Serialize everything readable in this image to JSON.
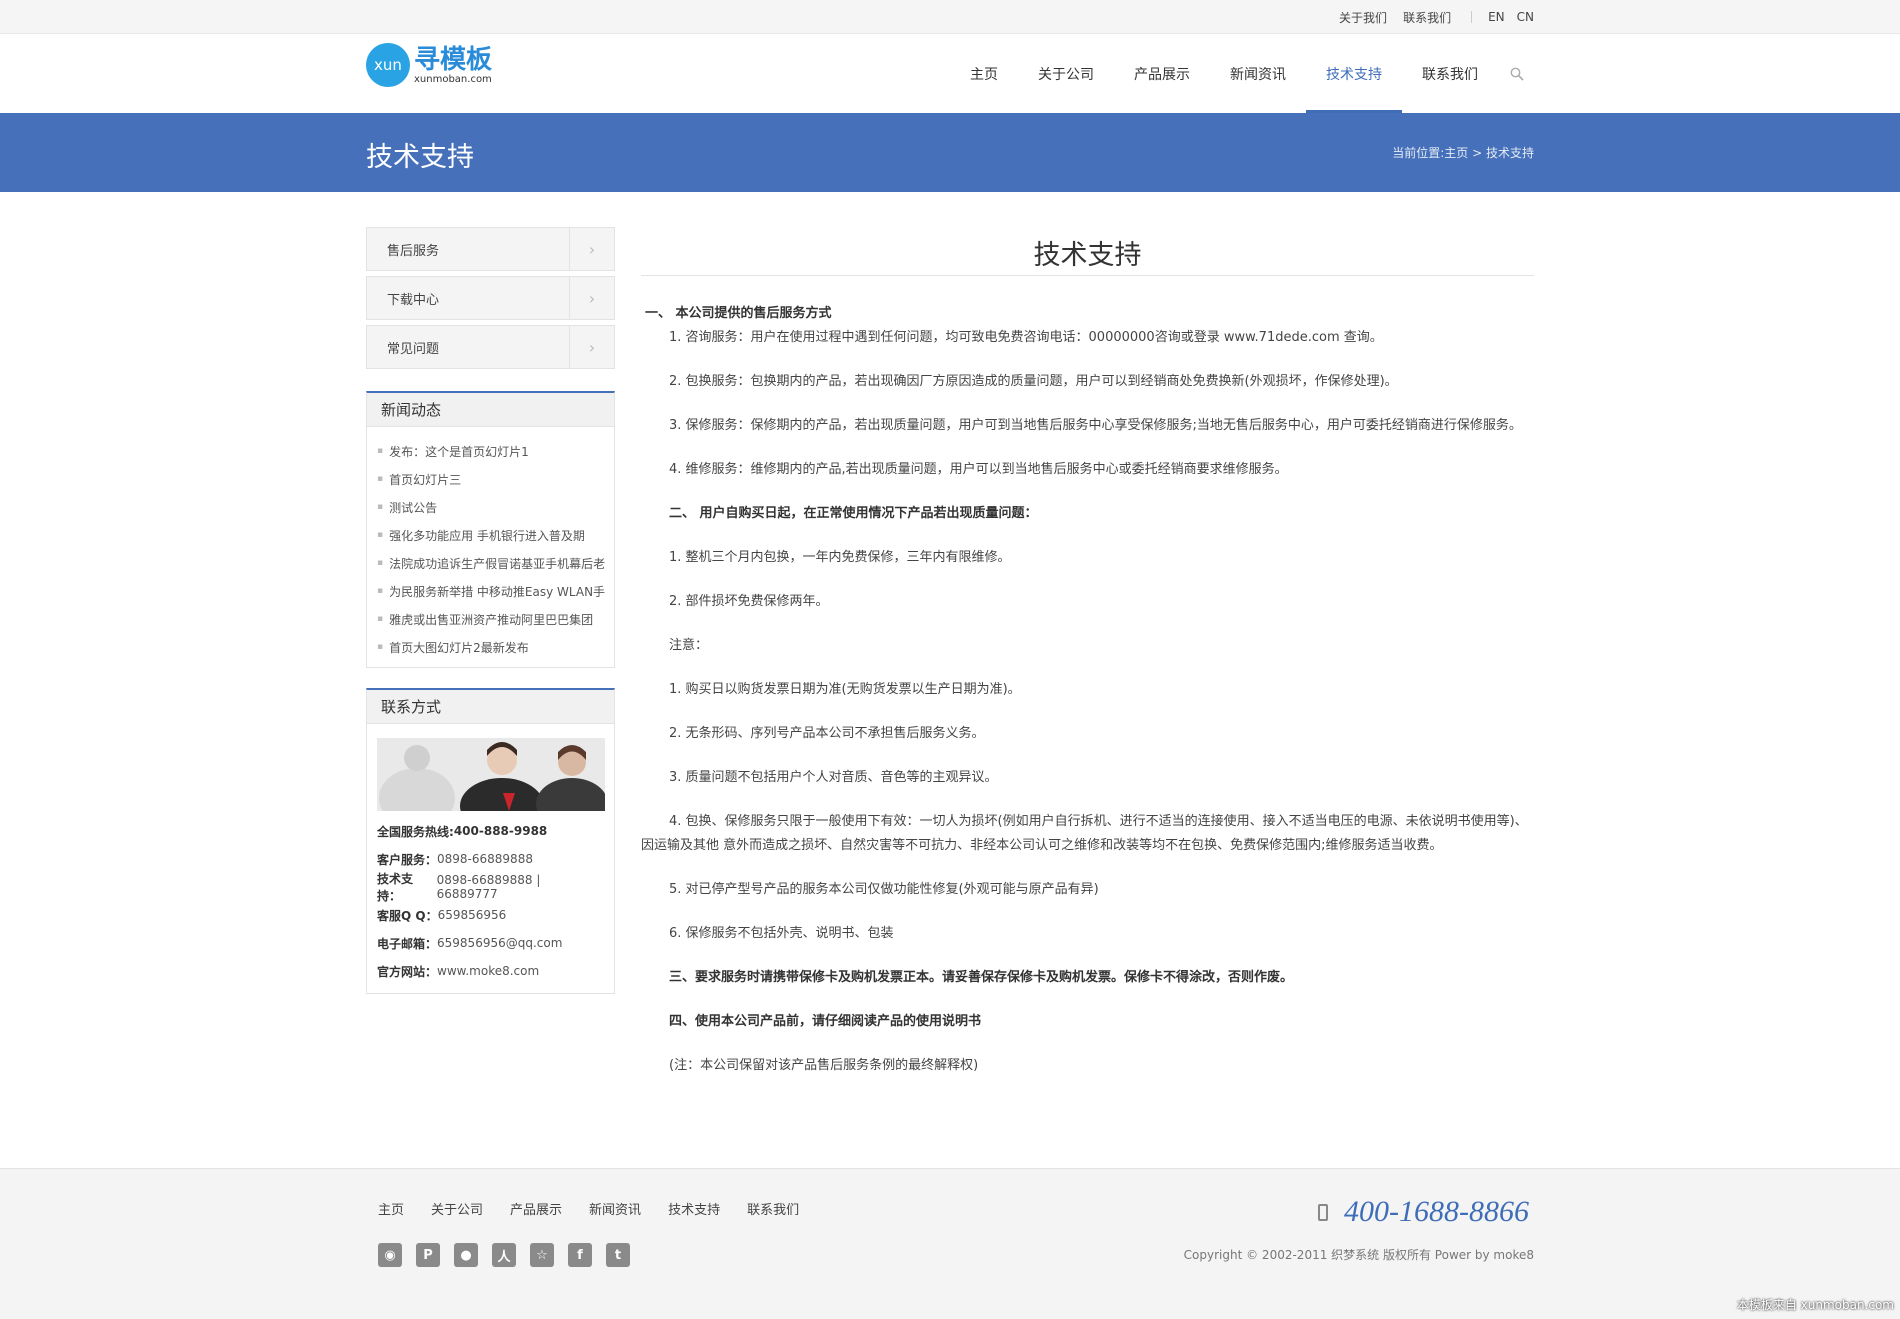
{
  "topbar": {
    "about": "关于我们",
    "contact": "联系我们",
    "en": "EN",
    "cn": "CN"
  },
  "logo": {
    "badge": "xun",
    "name": "寻模板",
    "domain": "xunmoban.com"
  },
  "nav": {
    "items": [
      "主页",
      "关于公司",
      "产品展示",
      "新闻资讯",
      "技术支持",
      "联系我们"
    ],
    "active_index": 4,
    "search_icon": "search-icon"
  },
  "banner": {
    "title": "技术支持",
    "breadcrumb": "当前位置:主页 > 技术支持"
  },
  "sidebar": {
    "menu": [
      "售后服务",
      "下载中心",
      "常见问题"
    ],
    "news": {
      "title": "新闻动态",
      "items": [
        "发布：这个是首页幻灯片1",
        "首页幻灯片三",
        "测试公告",
        "强化多功能应用 手机银行进入普及期",
        "法院成功追诉生产假冒诺基亚手机幕后老",
        "为民服务新举措 中移动推Easy WLAN手",
        "雅虎或出售亚洲资产推动阿里巴巴集团",
        "首页大图幻灯片2最新发布"
      ]
    },
    "contact": {
      "title": "联系方式",
      "hotline_label": "全国服务热线:",
      "hotline": "400-888-9988",
      "service_label": "客户服务：",
      "service": "0898-66889888",
      "tech_label": "技术支持：",
      "tech": "0898-66889888 | 66889777",
      "qq_label": "客服Q Q：",
      "qq": "659856956",
      "email_label": "电子邮箱：",
      "email": "659856956@qq.com",
      "web_label": "官方网站：",
      "web": "www.moke8.com"
    }
  },
  "content": {
    "title": "技术支持",
    "paragraphs": [
      "一、 本公司提供的售后服务方式",
      "1. 咨询服务：用户在使用过程中遇到任何问题，均可致电免费咨询电话：00000000咨询或登录 www.71dede.com 查询。",
      "2. 包换服务：包换期内的产品，若出现确因厂方原因造成的质量问题，用户可以到经销商处免费换新(外观损坏，作保修处理)。",
      "3. 保修服务：保修期内的产品，若出现质量问题，用户可到当地售后服务中心享受保修服务;当地无售后服务中心，用户可委托经销商进行保修服务。",
      "4. 维修服务：维修期内的产品,若出现质量问题，用户可以到当地售后服务中心或委托经销商要求维修服务。",
      "二、 用户自购买日起，在正常使用情况下产品若出现质量问题：",
      "1. 整机三个月内包换，一年内免费保修，三年内有限维修。",
      "2. 部件损坏免费保修两年。",
      "注意：",
      "1. 购买日以购货发票日期为准(无购货发票以生产日期为准)。",
      "2. 无条形码、序列号产品本公司不承担售后服务义务。",
      "3. 质量问题不包括用户个人对音质、音色等的主观异议。",
      "4. 包换、保修服务只限于一般使用下有效：一切人为损坏(例如用户自行拆机、进行不适当的连接使用、接入不适当电压的电源、未依说明书使用等)、因运输及其他 意外而造成之损坏、自然灾害等不可抗力、非经本公司认可之维修和改装等均不在包换、免费保修范围内;维修服务适当收费。",
      "5. 对已停产型号产品的服务本公司仅做功能性修复(外观可能与原产品有异)",
      "6. 保修服务不包括外壳、说明书、包装",
      "三、要求服务时请携带保修卡及购机发票正本。请妥善保存保修卡及购机发票。保修卡不得涂改，否则作废。",
      "四、使用本公司产品前，请仔细阅读产品的使用说明书",
      "(注：本公司保留对该产品售后服务条例的最终解释权)"
    ]
  },
  "footer": {
    "nav": [
      "主页",
      "关于公司",
      "产品展示",
      "新闻资讯",
      "技术支持",
      "联系我们"
    ],
    "social": [
      "weibo-icon",
      "pinterest-icon",
      "chat-icon",
      "renren-icon",
      "star-icon",
      "facebook-icon",
      "twitter-icon"
    ],
    "phone": "400-1688-8866",
    "copyright": "Copyright © 2002-2011 织梦系统 版权所有 Power by moke8"
  },
  "watermark": "本模板来自 xunmoban.com",
  "colors": {
    "accent": "#4670b9",
    "logo": "#2aa3e4"
  }
}
